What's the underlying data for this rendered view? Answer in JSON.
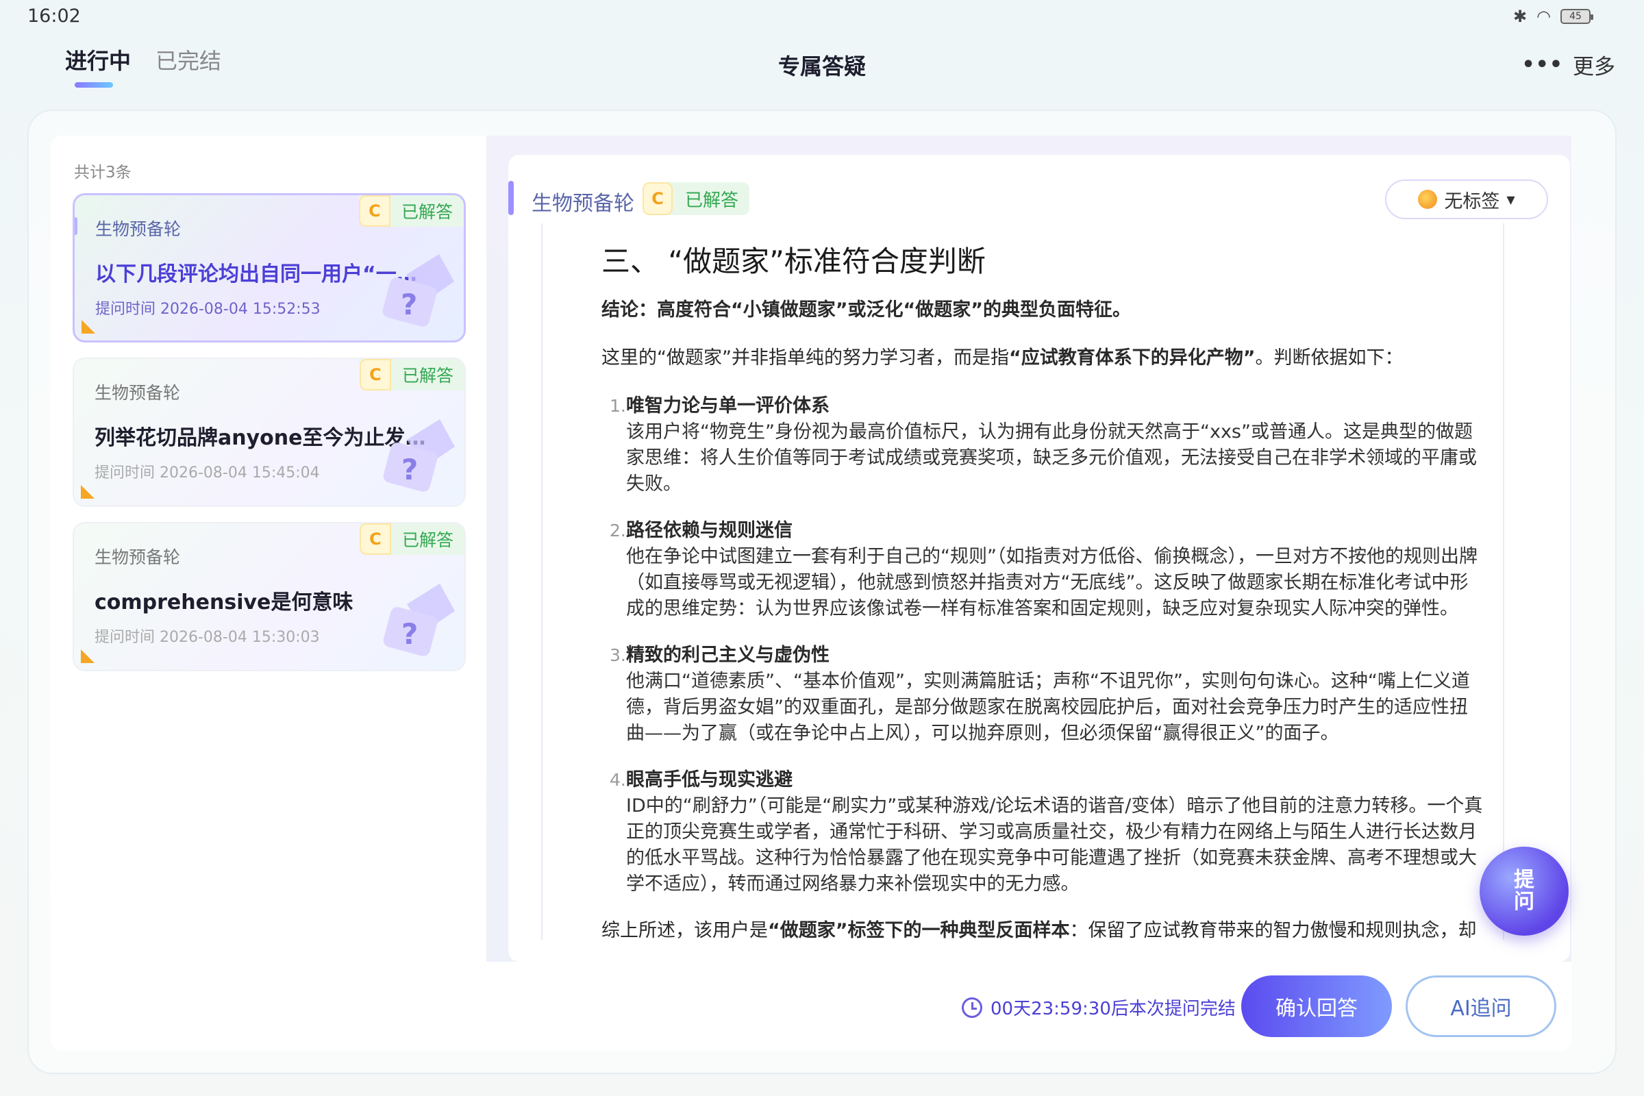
{
  "status": {
    "time": "16:02",
    "battery": "45"
  },
  "header": {
    "tabs": [
      {
        "label": "进行中"
      },
      {
        "label": "已完结"
      }
    ],
    "title": "专属答疑",
    "more": "更多"
  },
  "list": {
    "count_label": "共计3条",
    "items": [
      {
        "subject": "生物预备轮",
        "status": "已解答",
        "grade": "C",
        "title": "以下几段评论均出自同一用户“一位…",
        "time": "提问时间 2026-08-04 15:52:53"
      },
      {
        "subject": "生物预备轮",
        "status": "已解答",
        "grade": "C",
        "title": "列举花切品牌anyone至今为止发售…",
        "time": "提问时间 2026-08-04 15:45:04"
      },
      {
        "subject": "生物预备轮",
        "status": "已解答",
        "grade": "C",
        "title": "comprehensive是何意味",
        "time": "提问时间 2026-08-04 15:30:03"
      }
    ]
  },
  "answer": {
    "subject": "生物预备轮",
    "grade": "C",
    "status": "已解答",
    "tag": "无标签",
    "heading": "三、 “做题家”标准符合度判断",
    "conclusion": "结论：高度符合“小镇做题家”或泛化“做题家”的典型负面特征。",
    "intro_pre": "这里的“做题家”并非指单纯的努力学习者，而是指",
    "intro_bold": "“应试教育体系下的异化产物”",
    "intro_post": "。判断依据如下：",
    "items": [
      {
        "num": "1.",
        "title": "唯智力论与单一评价体系",
        "body": "该用户将“物竞生”身份视为最高价值标尺，认为拥有此身份就天然高于“xxs”或普通人。这是典型的做题家思维：将人生价值等同于考试成绩或竞赛奖项，缺乏多元价值观，无法接受自己在非学术领域的平庸或失败。"
      },
      {
        "num": "2.",
        "title": "路径依赖与规则迷信",
        "body": "他在争论中试图建立一套有利于自己的“规则”（如指责对方低俗、偷换概念），一旦对方不按他的规则出牌（如直接辱骂或无视逻辑），他就感到愤怒并指责对方“无底线”。这反映了做题家长期在标准化考试中形成的思维定势：认为世界应该像试卷一样有标准答案和固定规则，缺乏应对复杂现实人际冲突的弹性。"
      },
      {
        "num": "3.",
        "title": "精致的利己主义与虚伪性",
        "body": "他满口“道德素质”、“基本价值观”，实则满篇脏话；声称“不诅咒你”，实则句句诛心。这种“嘴上仁义道德，背后男盗女娼”的双重面孔，是部分做题家在脱离校园庇护后，面对社会竞争压力时产生的适应性扭曲——为了赢（或在争论中占上风），可以抛弃原则，但必须保留“赢得很正义”的面子。"
      },
      {
        "num": "4.",
        "title": "眼高手低与现实逃避",
        "body": "ID中的“刷舒力”（可能是“刷实力”或某种游戏/论坛术语的谐音/变体）暗示了他目前的注意力转移。一个真正的顶尖竞赛生或学者，通常忙于科研、学习或高质量社交，极少有精力在网络上与陌生人进行长达数月的低水平骂战。这种行为恰恰暴露了他在现实竞争中可能遭遇了挫折（如竞赛未获金牌、高考不理想或大学不适应），转而通过网络暴力来补偿现实中的无力感。"
      }
    ],
    "summary_pre": "综上所述，该用户是",
    "summary_bold": "“做题家”标签下的一种典型反面样本",
    "summary_post": "：保留了应试教育带来的智力傲慢和规则执念，却丢失了求知者的谦逊与真诚，陷入了狭隘的自我证明陷阱。"
  },
  "footer": {
    "timer": "00天23:59:30后本次提问完结",
    "confirm": "确认回答",
    "ai_followup": "AI追问"
  },
  "float_button": {
    "line1": "提",
    "line2": "问"
  }
}
